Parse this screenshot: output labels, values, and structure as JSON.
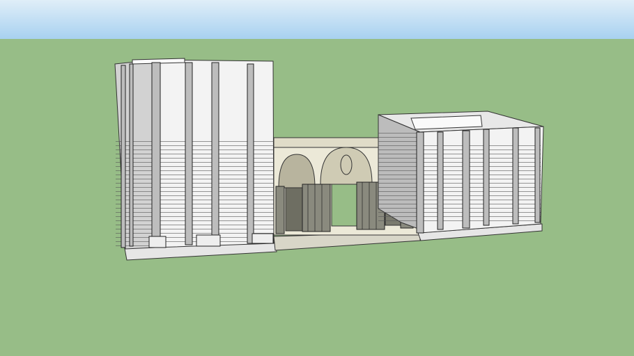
{
  "scene": {
    "sky_top_color": "#dcecf7",
    "sky_bottom_color": "#a9d2f0",
    "ground_color": "#97bd87",
    "wall_color": "#f2f2f2",
    "shade_color": "#c9c9c9",
    "arcade_color": "#ece9d8",
    "edge_color": "#333333"
  }
}
